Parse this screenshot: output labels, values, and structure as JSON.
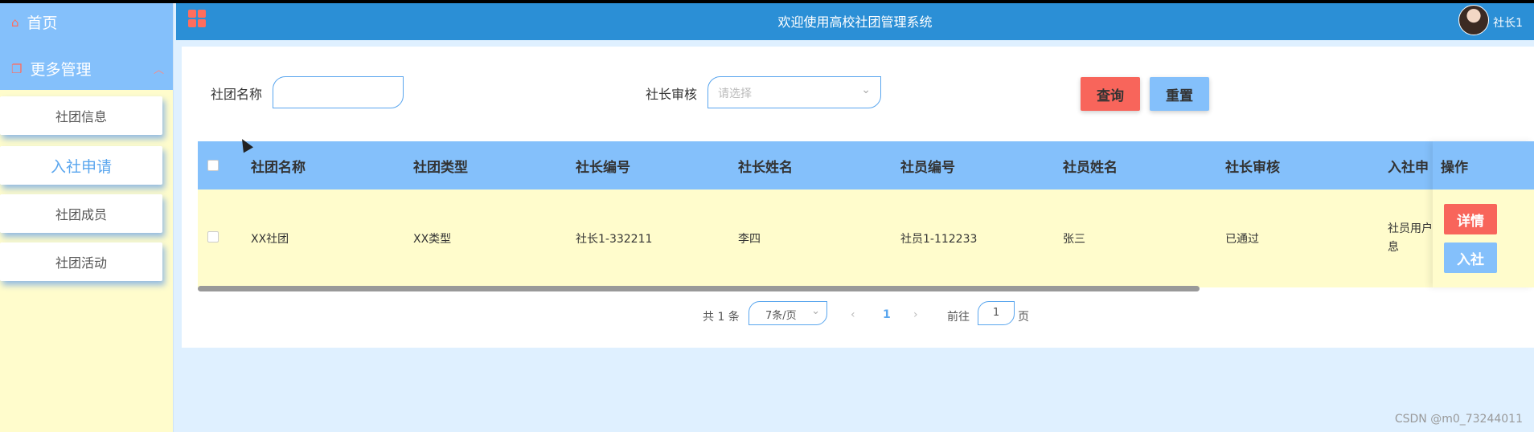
{
  "sidebar": {
    "home": "首页",
    "more": "更多管理",
    "items": [
      {
        "label": "社团信息"
      },
      {
        "label": "入社申请"
      },
      {
        "label": "社团成员"
      },
      {
        "label": "社团活动"
      }
    ]
  },
  "header": {
    "title": "欢迎使用高校社团管理系统",
    "user": "社长1"
  },
  "search": {
    "club_name_label": "社团名称",
    "club_name_value": "",
    "review_label": "社长审核",
    "review_placeholder": "请选择",
    "search_button": "查询",
    "reset_button": "重置"
  },
  "table": {
    "columns": [
      "社团名称",
      "社团类型",
      "社长编号",
      "社长姓名",
      "社员编号",
      "社员姓名",
      "社长审核",
      "入社申"
    ],
    "ops_header": "操作",
    "rows": [
      {
        "cells": [
          "XX社团",
          "XX类型",
          "社长1-332211",
          "李四",
          "社员1-112233",
          "张三",
          "已通过"
        ],
        "info_line1": "社员用户",
        "info_line2": "息",
        "detail_button": "详情",
        "join_button": "入社"
      }
    ]
  },
  "pagination": {
    "total": "共 1 条",
    "page_size": "7条/页",
    "current_page": "1",
    "goto_label": "前往",
    "goto_value": "1",
    "page_suffix": "页",
    "prev": "‹",
    "next": "›"
  },
  "watermark": "CSDN @m0_73244011",
  "colors": {
    "sidebar_bg": "#fffccc",
    "accent_blue": "#84c0fb",
    "header_blue": "#2b8fd6",
    "danger": "#f8655b"
  }
}
